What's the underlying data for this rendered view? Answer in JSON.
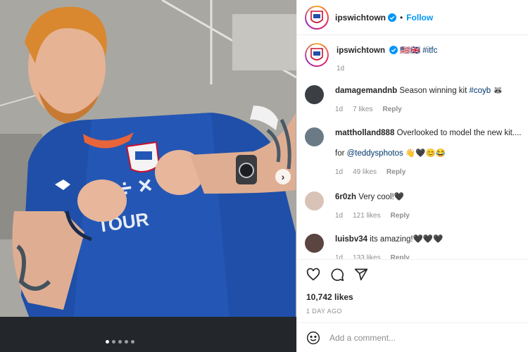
{
  "post": {
    "username": "ipswichtown",
    "follow_label": "Follow",
    "separator": "•",
    "caption_flags": "🇺🇸🇬🇧",
    "caption_tag": "#itfc",
    "caption_age": "1d",
    "likes": "10,742 likes",
    "date": "1 DAY AGO",
    "add_comment_placeholder": "Add a comment...",
    "media_dots": 5,
    "media_active_dot": 0
  },
  "comments": [
    {
      "user": "damagemandnb",
      "text": "Season winning kit ",
      "tag": "#coyb",
      "suffix": " 🦝",
      "age": "1d",
      "likes": "7 likes",
      "reply": "Reply"
    },
    {
      "user": "mattholland888",
      "text": "Overlooked to model the new kit....",
      "text2": "for ",
      "tag": "@teddysphotos",
      "suffix": " 👋🖤😊😂",
      "age": "1d",
      "likes": "49 likes",
      "reply": "Reply"
    },
    {
      "user": "6r0zh",
      "text": "Very cool!🖤",
      "age": "1d",
      "likes": "121 likes",
      "reply": "Reply"
    },
    {
      "user": "luisbv34",
      "text": "its amazing!🖤🖤🖤",
      "age": "1d",
      "likes": "133 likes",
      "reply": "Reply"
    }
  ],
  "colors": {
    "accent": "#0095f6",
    "hashtag": "#00376b",
    "muted": "#8e8e8e",
    "jersey_blue": "#1f4fa8"
  },
  "icons": [
    "like-icon",
    "comment-icon",
    "share-icon",
    "emoji-icon",
    "verified-icon",
    "next-arrow-icon"
  ]
}
